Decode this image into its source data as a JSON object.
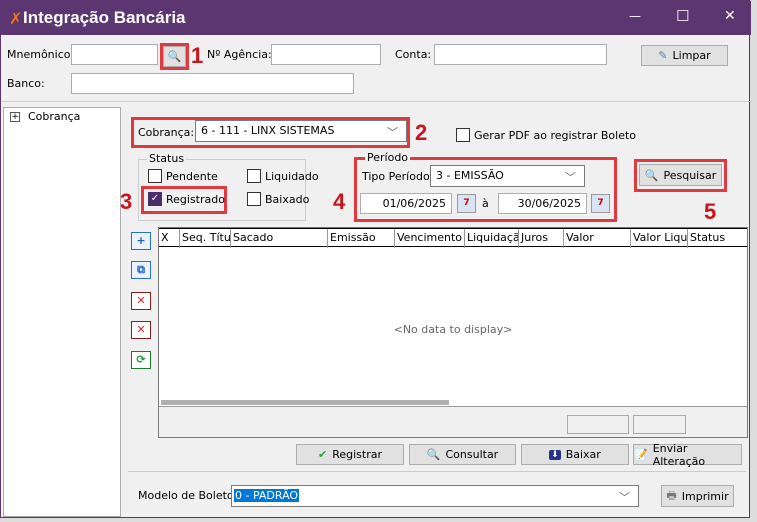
{
  "window": {
    "title": "Integração Bancária",
    "minimize": "—",
    "maximize": "☐",
    "close": "✕"
  },
  "header": {
    "mnemonico_label": "Mnemônico:",
    "mnemonico_value": "",
    "agencia_label": "Nº Agência:",
    "agencia_value": "",
    "conta_label": "Conta:",
    "conta_value": "",
    "banco_label": "Banco:",
    "banco_value": "",
    "limpar_label": "Limpar"
  },
  "tree": {
    "items": [
      {
        "label": "Cobrança",
        "expander": "+"
      }
    ]
  },
  "filters": {
    "cobranca_label": "Cobrança:",
    "cobranca_value": "6 - 111 - LINX SISTEMAS",
    "gerar_pdf_label": "Gerar PDF ao registrar Boleto",
    "gerar_pdf_checked": false,
    "status_title": "Status",
    "status": [
      {
        "label": "Pendente",
        "checked": false
      },
      {
        "label": "Liquidado",
        "checked": false
      },
      {
        "label": "Registrado",
        "checked": true
      },
      {
        "label": "Baixado",
        "checked": false
      }
    ],
    "periodo_title": "Período",
    "tipo_periodo_label": "Tipo Período:",
    "tipo_periodo_value": "3 - EMISSÃO",
    "date_from": "01/06/2025",
    "date_sep": "à",
    "date_to": "30/06/2025",
    "pesquisar_label": "Pesquisar"
  },
  "annotations": [
    "1",
    "2",
    "3",
    "4",
    "5"
  ],
  "grid": {
    "columns": [
      "X",
      "Seq. Títul",
      "Sacado",
      "Emissão",
      "Vencimento",
      "Liquidação",
      "Juros",
      "Valor",
      "Valor Liquic",
      "Status"
    ],
    "rows": [],
    "empty_text": "<No data to display>"
  },
  "actions": {
    "registrar": "Registrar",
    "consultar": "Consultar",
    "baixar": "Baixar",
    "enviar": "Enviar Alteração"
  },
  "footer": {
    "modelo_label": "Modelo de Boleto:",
    "modelo_value": "0 - PADRÃO",
    "imprimir_label": "Imprimir"
  },
  "colors": {
    "titlebar": "#5b3670",
    "annotation": "#e0393e",
    "selection": "#0078d7"
  }
}
